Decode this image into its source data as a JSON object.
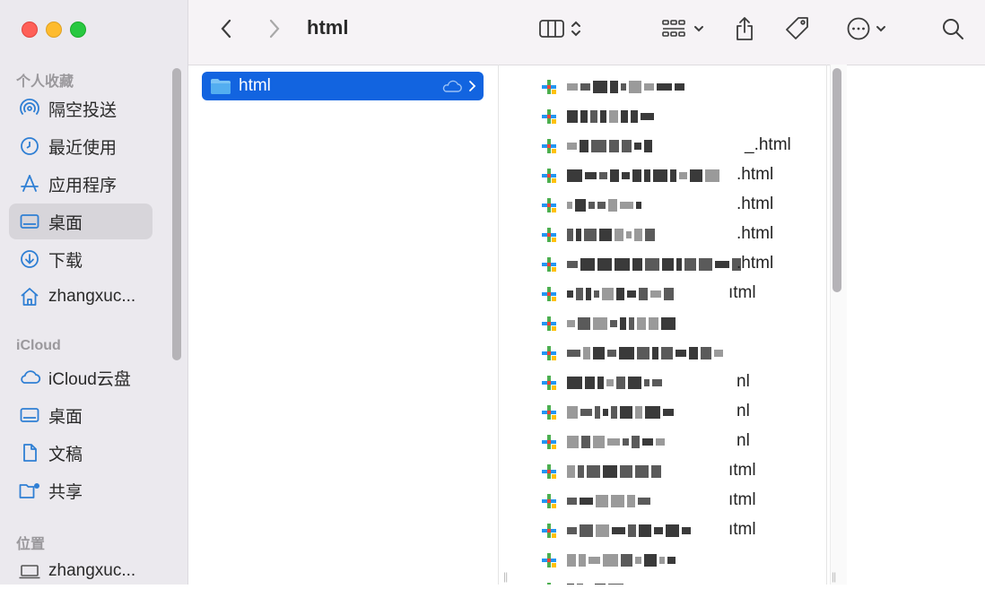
{
  "window": {
    "title": "html"
  },
  "sidebar": {
    "favorites_title": "个人收藏",
    "favorites": [
      {
        "label": "隔空投送",
        "icon": "airdrop-icon"
      },
      {
        "label": "最近使用",
        "icon": "clock-icon"
      },
      {
        "label": "应用程序",
        "icon": "apps-icon"
      },
      {
        "label": "桌面",
        "icon": "desktop-icon",
        "selected": true
      },
      {
        "label": "下载",
        "icon": "download-icon"
      },
      {
        "label": "zhangxuc...",
        "icon": "home-icon"
      }
    ],
    "icloud_title": "iCloud",
    "icloud": [
      {
        "label": "iCloud云盘",
        "icon": "cloud-icon"
      },
      {
        "label": "桌面",
        "icon": "desktop-icon"
      },
      {
        "label": "文稿",
        "icon": "document-icon"
      },
      {
        "label": "共享",
        "icon": "shared-folder-icon"
      }
    ],
    "locations_title": "位置",
    "locations": [
      {
        "label": "zhangxuc...",
        "icon": "laptop-icon"
      }
    ]
  },
  "column1": {
    "selected_folder": "html"
  },
  "column2": {
    "files": [
      {
        "name": "",
        "icon_color": "#e6a23c"
      },
      {
        "name": "",
        "icon_color": "#e6a23c"
      },
      {
        "name": "_.html",
        "icon_color": "#e6a23c"
      },
      {
        "name": ".html",
        "icon_color": "#e6a23c"
      },
      {
        "name": ".html",
        "icon_color": "#e6a23c"
      },
      {
        "name": ".html",
        "icon_color": "#e6a23c"
      },
      {
        "name": ".html",
        "icon_color": "#e6a23c"
      },
      {
        "name": "ıtml",
        "icon_color": "#e6a23c"
      },
      {
        "name": "",
        "icon_color": "#e6a23c"
      },
      {
        "name": "",
        "icon_color": "#e6a23c"
      },
      {
        "name": "nl",
        "icon_color": "#e6a23c"
      },
      {
        "name": "nl",
        "icon_color": "#e6a23c"
      },
      {
        "name": "nl",
        "icon_color": "#e6a23c"
      },
      {
        "name": "ıtml",
        "icon_color": "#e6a23c"
      },
      {
        "name": "ıtml",
        "icon_color": "#e6a23c"
      },
      {
        "name": "ıtml",
        "icon_color": "#e6a23c"
      },
      {
        "name": "",
        "icon_color": "#e6a23c"
      },
      {
        "name": "",
        "icon_color": "#e6a23c"
      }
    ]
  },
  "colors": {
    "accent": "#1264e0",
    "sidebar_icon": "#2f7fd4"
  }
}
